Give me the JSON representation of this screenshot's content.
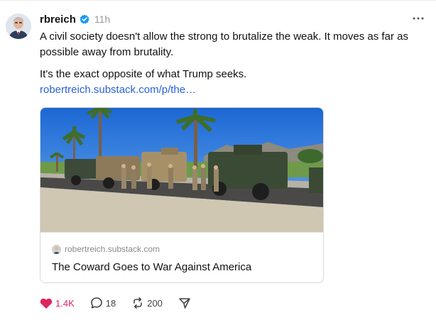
{
  "post": {
    "author": "rbreich",
    "timestamp": "11h",
    "paragraphs": [
      "A civil society doesn't allow the strong to brutalize the weak. It moves as far as possible away from brutality.",
      "It's the exact opposite of what Trump seeks."
    ],
    "link_text": "robertreich.substack.com/p/the…",
    "card": {
      "domain": "robertreich.substack.com",
      "title": "The Coward Goes to War Against America"
    },
    "actions": {
      "likes": "1.4K",
      "replies": "18",
      "reposts": "200"
    }
  },
  "colors": {
    "accent_link": "#2a62d7",
    "like": "#e0245e",
    "verified": "#1d9bf0"
  },
  "icons": {
    "verified": "verified-badge-icon",
    "more": "more-options-icon",
    "like": "heart-icon",
    "reply": "comment-bubble-icon",
    "repost": "repost-icon",
    "share": "share-send-icon"
  }
}
